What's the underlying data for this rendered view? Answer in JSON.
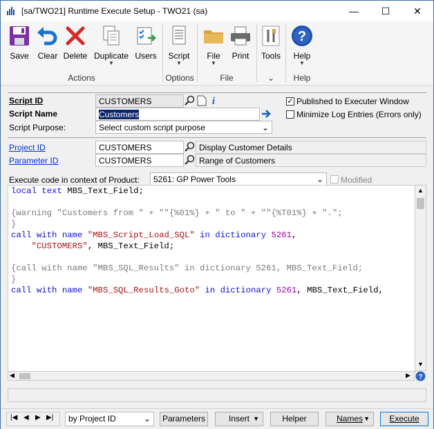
{
  "window": {
    "title": "[sa/TWO21] Runtime Execute Setup  -  TWO21 (sa)",
    "minimize": "—",
    "maximize": "☐",
    "close": "✕"
  },
  "ribbon": {
    "buttons": {
      "save": "Save",
      "clear": "Clear",
      "delete": "Delete",
      "duplicate": "Duplicate",
      "users": "Users",
      "script": "Script",
      "file": "File",
      "print": "Print",
      "tools": "Tools",
      "help": "Help"
    },
    "groups": {
      "actions": "Actions",
      "options": "Options",
      "file": "File",
      "tools": "⌄",
      "help": "Help"
    }
  },
  "form": {
    "script_id_label": "Script ID",
    "script_id_value": "CUSTOMERS",
    "script_name_label": "Script Name",
    "script_name_value": "Customers",
    "script_purpose_label": "Script Purpose:",
    "script_purpose_value": "Select custom script purpose",
    "published_label": "Published to Executer Window",
    "published_checked": true,
    "minimize_log_label": "Minimize Log Entries (Errors only)",
    "minimize_log_checked": false,
    "project_id_label": "Project ID",
    "project_id_value": "CUSTOMERS",
    "project_desc": "Display Customer Details",
    "parameter_id_label": "Parameter ID",
    "parameter_id_value": "CUSTOMERS",
    "parameter_desc": "Range of Customers",
    "product_label": "Execute code in context of Product:",
    "product_value": "5261: GP Power Tools",
    "modified_label": "Modified"
  },
  "code_lines": [
    "local text MBS_Text_Field;",
    "",
    "{warning \"Customers from \" + \"\"{%01%} + \" to \" + \"\"{%T01%} + \".\";",
    "}",
    "call with name \"MBS_Script_Load_SQL\" in dictionary 5261,",
    "    \"CUSTOMERS\", MBS_Text_Field;",
    "",
    "{call with name \"MBS_SQL_Results\" in dictionary 5261, MBS_Text_Field;",
    "}",
    "call with name \"MBS_SQL_Results_Goto\" in dictionary 5261, MBS_Text_Field,"
  ],
  "bottom": {
    "sort_value": "by Project ID",
    "parameters": "Parameters",
    "insert": "Insert",
    "helper": "Helper",
    "names": "Names",
    "execute": "Execute"
  },
  "colors": {
    "keyword": "#1010d0",
    "string": "#a31515",
    "number": "#a000a0",
    "comment": "#7a7a7a"
  }
}
